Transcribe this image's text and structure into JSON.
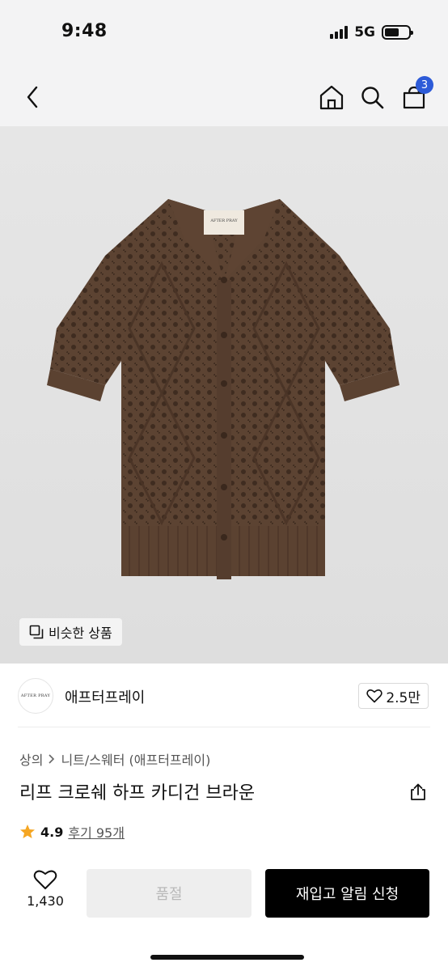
{
  "status_bar": {
    "time": "9:48",
    "network": "5G"
  },
  "nav": {
    "cart_count": "3"
  },
  "image": {
    "similar_label": "비슷한 상품",
    "label_text": "AFTER PRAY"
  },
  "brand": {
    "name": "애프터프레이",
    "logo_text": "AFTER PRAY",
    "likes": "2.5만"
  },
  "product": {
    "breadcrumb": [
      "상의",
      "니트/스웨터 (애프터프레이)"
    ],
    "title": "리프 크로쉐 하프 카디건 브라운",
    "rating": "4.9",
    "reviews": "후기 95개"
  },
  "bottom": {
    "wish_count": "1,430",
    "soldout_label": "품절",
    "restock_label": "재입고 알림 신청"
  },
  "colors": {
    "accent": "#2d5bd8",
    "garment": "#5a4130",
    "primary_button": "#000000"
  }
}
